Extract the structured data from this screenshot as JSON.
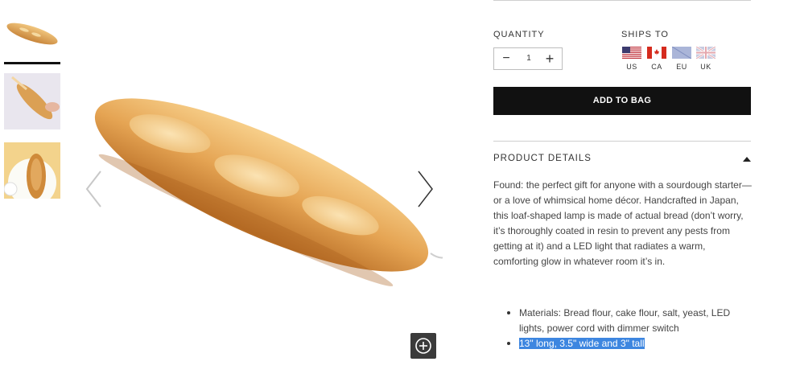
{
  "thumbnails": [
    {
      "name": "thumb-baguette-lamp"
    },
    {
      "name": "thumb-baguette-hand"
    },
    {
      "name": "thumb-baguette-plate"
    }
  ],
  "quantity": {
    "label": "QUANTITY",
    "value": "1",
    "minus_symbol": "−",
    "plus_symbol": "+"
  },
  "ships_to": {
    "label": "SHIPS TO",
    "regions": [
      {
        "code": "US",
        "icon": "us-flag-icon"
      },
      {
        "code": "CA",
        "icon": "ca-flag-icon"
      },
      {
        "code": "EU",
        "icon": "eu-flag-icon"
      },
      {
        "code": "UK",
        "icon": "uk-flag-icon"
      }
    ]
  },
  "add_to_bag_label": "ADD TO BAG",
  "product_details": {
    "title": "PRODUCT DETAILS",
    "description": "Found: the perfect gift for anyone with a sourdough starter—or a love of whimsical home décor. Handcrafted in Japan, this loaf-shaped lamp is made of actual bread (don’t worry, it’s thoroughly coated in resin to prevent any pests from getting at it) and a LED light that radiates a warm, comforting glow in whatever room it’s in.",
    "bullets": [
      "Materials: Bread flour, cake flour, salt, yeast, LED lights, power cord with dimmer switch",
      "13\" long, 3.5\" wide and 3\" tall"
    ]
  },
  "colors": {
    "button_bg": "#111111",
    "highlight": "#3d86e0",
    "zoom_bg": "#3b3b3b"
  }
}
